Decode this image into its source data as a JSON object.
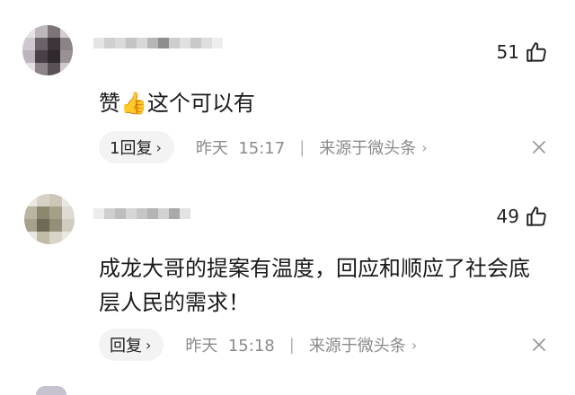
{
  "comments": [
    {
      "username": "",
      "likes": "51",
      "text": "赞👍这个可以有",
      "reply_label": "1回复",
      "time": "昨天",
      "clock": "15:17",
      "separator": "|",
      "source": "来源于微头条",
      "icons": {
        "like": "thumbs-up-icon",
        "close": "close-icon",
        "chevron": "chevron-right-icon"
      }
    },
    {
      "username": "",
      "likes": "49",
      "text": "成龙大哥的提案有温度，回应和顺应了社会底层人民的需求！",
      "reply_label": "回复",
      "time": "昨天",
      "clock": "15:18",
      "separator": "|",
      "source": "来源于微头条",
      "icons": {
        "like": "thumbs-up-icon",
        "close": "close-icon",
        "chevron": "chevron-right-icon"
      }
    }
  ],
  "colors": {
    "meta_gray": "#8a8a8a",
    "reply_bg": "#f3f3f3",
    "text": "#1a1a1a"
  }
}
